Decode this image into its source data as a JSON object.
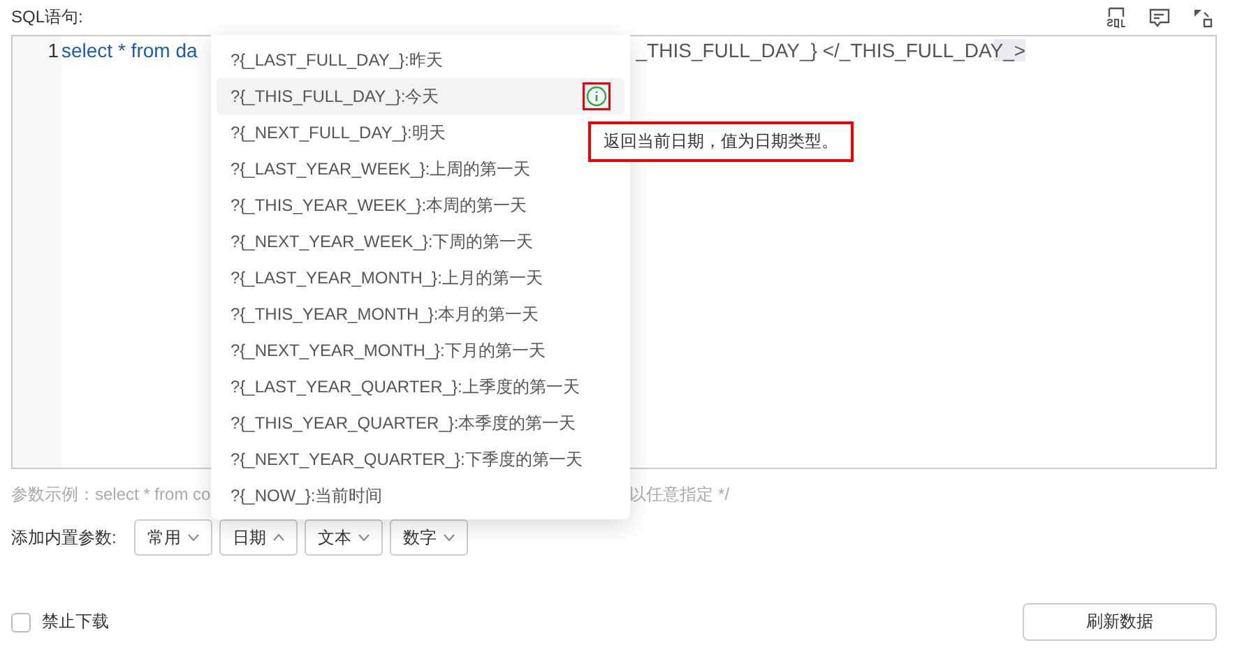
{
  "sql_label": "SQL语句:",
  "toolbar": [
    {
      "kind": "sql"
    },
    {
      "kind": "comment"
    },
    {
      "kind": "fullscreen"
    }
  ],
  "editor": {
    "line_number": "1",
    "code_visible_start": "select * from da",
    "code_visible_end": "_THIS_FULL_DAY_} </_THIS_FULL_DAY_>"
  },
  "dropdown": {
    "items": [
      {
        "label": "?{_LAST_FULL_DAY_}:昨天",
        "hovered": false
      },
      {
        "label": "?{_THIS_FULL_DAY_}:今天",
        "hovered": true
      },
      {
        "label": "?{_NEXT_FULL_DAY_}:明天",
        "hovered": false
      },
      {
        "label": "?{_LAST_YEAR_WEEK_}:上周的第一天",
        "hovered": false
      },
      {
        "label": "?{_THIS_YEAR_WEEK_}:本周的第一天",
        "hovered": false
      },
      {
        "label": "?{_NEXT_YEAR_WEEK_}:下周的第一天",
        "hovered": false
      },
      {
        "label": "?{_LAST_YEAR_MONTH_}:上月的第一天",
        "hovered": false
      },
      {
        "label": "?{_THIS_YEAR_MONTH_}:本月的第一天",
        "hovered": false
      },
      {
        "label": "?{_NEXT_YEAR_MONTH_}:下月的第一天",
        "hovered": false
      },
      {
        "label": "?{_LAST_YEAR_QUARTER_}:上季度的第一天",
        "hovered": false
      },
      {
        "label": "?{_THIS_YEAR_QUARTER_}:本季度的第一天",
        "hovered": false
      },
      {
        "label": "?{_NEXT_YEAR_QUARTER_}:下季度的第一天",
        "hovered": false
      },
      {
        "label": "?{_NOW_}:当前时间",
        "hovered": false
      }
    ],
    "tooltip": "返回当前日期，值为日期类型。"
  },
  "example_start": "参数示例：select * from co",
  "example_end": "以任意指定 */",
  "params_label": "添加内置参数:",
  "param_buttons": [
    {
      "label": "常用",
      "expanded": false
    },
    {
      "label": "日期",
      "expanded": true
    },
    {
      "label": "文本",
      "expanded": false
    },
    {
      "label": "数字",
      "expanded": false
    }
  ],
  "disable_download": {
    "label": "禁止下载",
    "checked": false
  },
  "refresh_button": "刷新数据"
}
